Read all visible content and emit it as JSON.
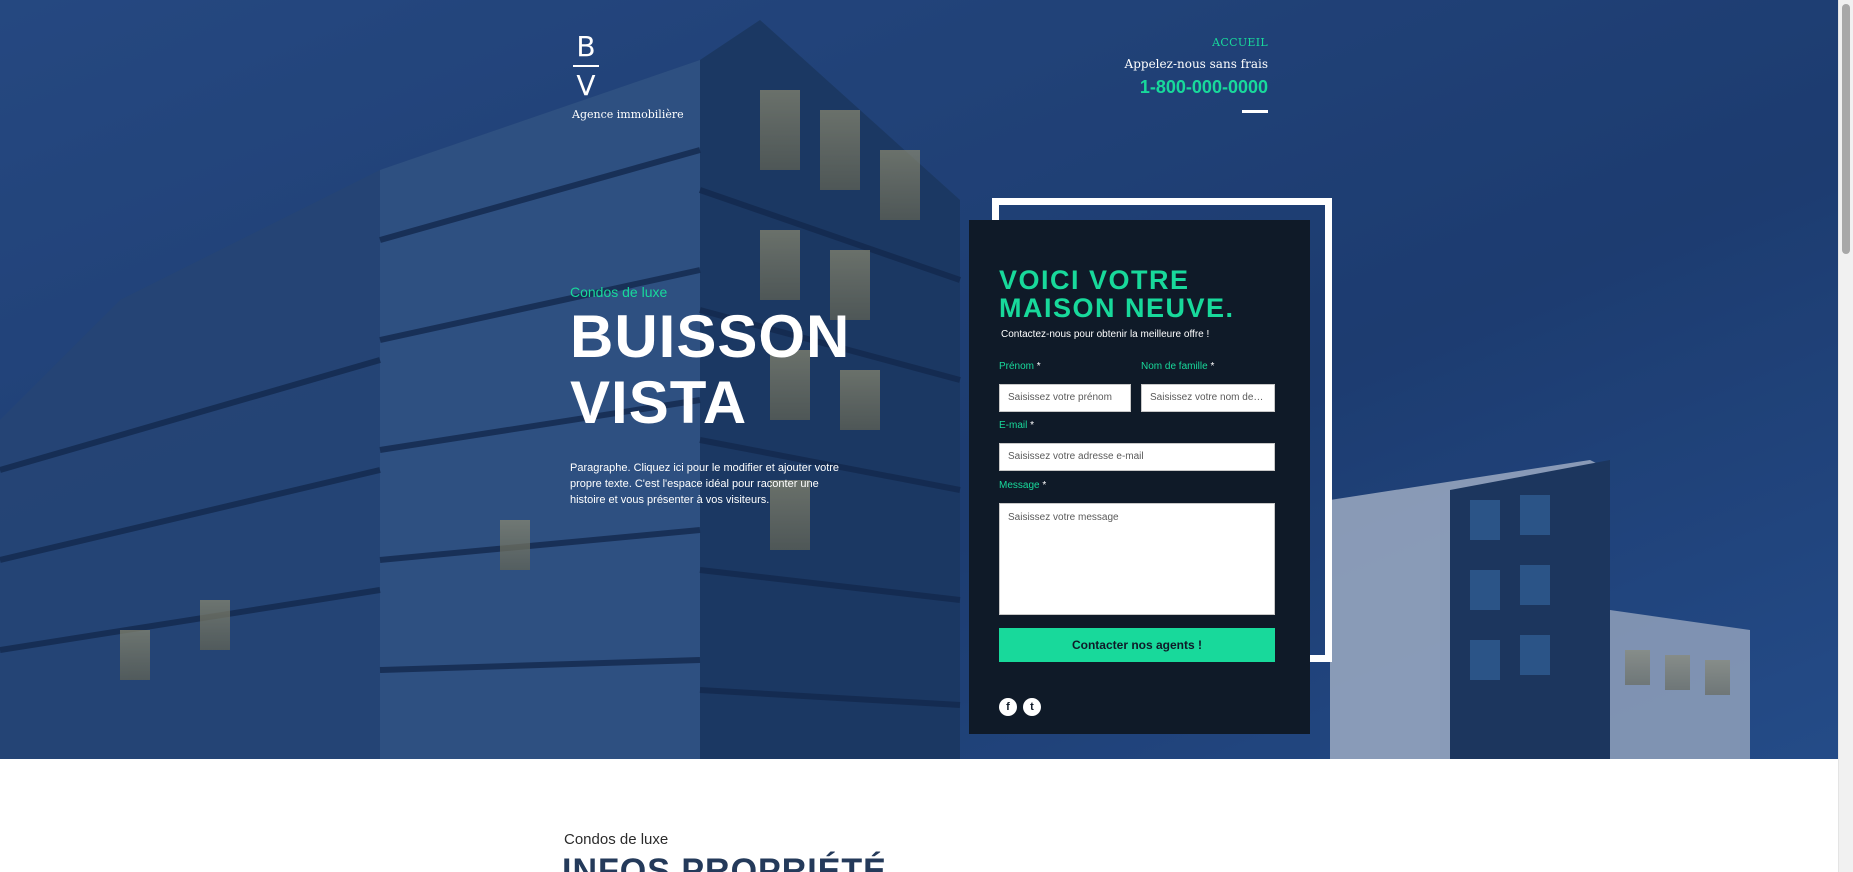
{
  "logo": {
    "top_letter": "B",
    "bottom_letter": "V",
    "tagline": "Agence immobilière"
  },
  "nav": {
    "home": "ACCUEIL",
    "call_label": "Appelez-nous sans frais",
    "phone": "1-800-000-0000"
  },
  "hero": {
    "kicker": "Condos de luxe",
    "title_line1": "BUISSON",
    "title_line2": "VISTA",
    "paragraph": "Paragraphe. Cliquez ici pour le modifier et ajouter votre propre texte. C'est l'espace idéal pour raconter une histoire et vous présenter à vos visiteurs."
  },
  "form": {
    "title_line1": "VOICI VOTRE",
    "title_line2": "MAISON NEUVE.",
    "subtitle": "Contactez-nous pour obtenir la meilleure offre !",
    "first_name_label": "Prénom",
    "first_name_placeholder": "Saisissez votre prénom",
    "last_name_label": "Nom de famille",
    "last_name_placeholder": "Saisissez votre nom de famille",
    "email_label": "E-mail",
    "email_placeholder": "Saisissez votre adresse e-mail",
    "message_label": "Message",
    "message_placeholder": "Saisissez votre message",
    "required_mark": "*",
    "submit": "Contacter nos agents !"
  },
  "social": {
    "facebook": "f",
    "twitter": "t"
  },
  "section": {
    "kicker": "Condos de luxe",
    "title": "INFOS PROPRIÉTÉ"
  },
  "colors": {
    "accent": "#18d99b",
    "card_bg": "#0f1a28",
    "hero_blue": "#213f70"
  }
}
